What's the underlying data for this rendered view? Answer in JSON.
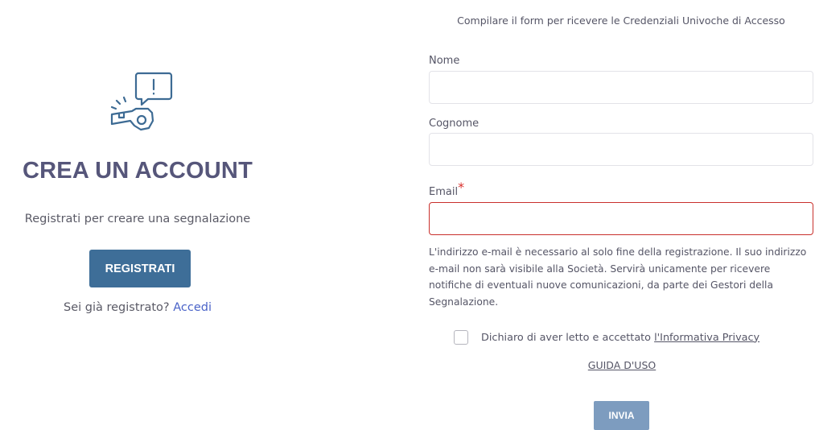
{
  "left": {
    "icon": "whistle-alert-icon",
    "title": "CREA UN ACCOUNT",
    "subtitle": "Registrati per creare una segnalazione",
    "register_label": "REGISTRATI",
    "login_prompt": "Sei già registrato?",
    "login_link": "Accedi"
  },
  "form": {
    "hint": "Compilare il form per ricevere le Credenziali Univoche di Accesso",
    "nome_label": "Nome",
    "nome_value": "",
    "cognome_label": "Cognome",
    "cognome_value": "",
    "email_label": "Email",
    "email_required_mark": "*",
    "email_value": "",
    "email_note": "L'indirizzo e-mail è necessario al solo fine della registrazione. Il suo indirizzo e-mail non sarà visibile alla Società. Servirà unicamente per ricevere notifiche di eventuali nuove comunicazioni, da parte dei Gestori della Segnalazione.",
    "consent_text": "Dichiaro di aver letto e accettato",
    "privacy_link": "l'Informativa Privacy",
    "guide_link": "GUIDA D'USO",
    "submit_label": "INVIA"
  },
  "colors": {
    "title": "#56567a",
    "primary_button": "#3e6e98",
    "submit_button_disabled": "#7d9cbf",
    "link": "#4a63c8",
    "error_border": "#c9302c"
  }
}
